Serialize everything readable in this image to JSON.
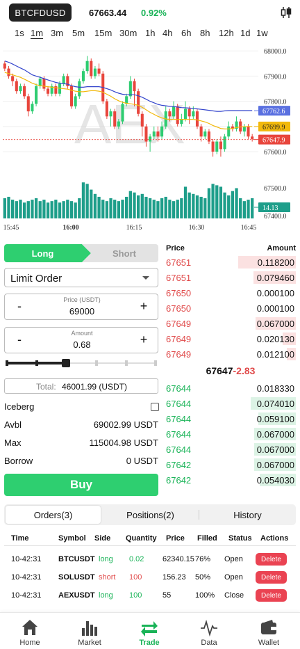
{
  "header": {
    "symbol": "BTCFDUSD",
    "last_price": "67663.44",
    "change_pct": "0.92%"
  },
  "intervals": {
    "items": [
      "1s",
      "1m",
      "3m",
      "5m",
      "15m",
      "30m",
      "1h",
      "4h",
      "6h",
      "8h",
      "12h",
      "1d",
      "1w"
    ],
    "active": "1m"
  },
  "chart": {
    "watermark": "AEX",
    "y_ticks": [
      "68000.0",
      "67900.0",
      "67800.0",
      "67600.0",
      "67500.0",
      "67400.0"
    ],
    "x_ticks": [
      "15:45",
      "16:00",
      "16:15",
      "16:30",
      "16:45"
    ],
    "price_tags": {
      "ma_blue": "67762.6",
      "ma_yellow": "67699.9",
      "last": "67647.9",
      "volume": "14.13"
    },
    "colors": {
      "up": "#2ecc71",
      "down": "#e8453c",
      "ma_blue": "#3344cc",
      "ma_yellow": "#f2b90c",
      "volume": "#1e9e8a"
    }
  },
  "chart_data": {
    "type": "candlestick",
    "interval": "1m",
    "x": [
      "15:45",
      "16:00",
      "16:15",
      "16:30",
      "16:45"
    ],
    "ylim": [
      67400,
      68020
    ],
    "candles": [
      [
        67950,
        67930,
        67960,
        67920
      ],
      [
        67930,
        67900,
        67940,
        67890
      ],
      [
        67900,
        67880,
        67910,
        67860
      ],
      [
        67880,
        67840,
        67890,
        67830
      ],
      [
        67840,
        67860,
        67870,
        67830
      ],
      [
        67860,
        67820,
        67870,
        67810
      ],
      [
        67820,
        67760,
        67830,
        67740
      ],
      [
        67760,
        67790,
        67800,
        67750
      ],
      [
        67790,
        67860,
        67870,
        67780
      ],
      [
        67860,
        67890,
        67900,
        67850
      ],
      [
        67890,
        67850,
        67900,
        67840
      ],
      [
        67850,
        67830,
        67860,
        67820
      ],
      [
        67830,
        67860,
        67870,
        67820
      ],
      [
        67860,
        67830,
        67870,
        67820
      ],
      [
        67830,
        67870,
        67880,
        67820
      ],
      [
        67870,
        67900,
        67910,
        67860
      ],
      [
        67900,
        67860,
        67910,
        67850
      ],
      [
        67860,
        67780,
        67870,
        67770
      ],
      [
        67780,
        67820,
        67830,
        67770
      ],
      [
        67820,
        67880,
        67890,
        67810
      ],
      [
        67880,
        67920,
        67930,
        67870
      ],
      [
        67920,
        67960,
        67980,
        67910
      ],
      [
        67960,
        67900,
        67970,
        67890
      ],
      [
        67900,
        67930,
        67940,
        67890
      ],
      [
        67930,
        67910,
        67950,
        67900
      ],
      [
        67910,
        67800,
        67920,
        67790
      ],
      [
        67800,
        67740,
        67810,
        67730
      ],
      [
        67740,
        67760,
        67770,
        67700
      ],
      [
        67760,
        67700,
        67770,
        67690
      ],
      [
        67700,
        67720,
        67730,
        67690
      ],
      [
        67720,
        67790,
        67800,
        67710
      ],
      [
        67790,
        67820,
        67830,
        67780
      ],
      [
        67820,
        67880,
        67900,
        67810
      ],
      [
        67880,
        67840,
        67890,
        67780
      ],
      [
        67840,
        67750,
        67850,
        67740
      ],
      [
        67750,
        67700,
        67760,
        67660
      ],
      [
        67700,
        67640,
        67710,
        67620
      ],
      [
        67640,
        67660,
        67670,
        67600
      ],
      [
        67660,
        67680,
        67700,
        67650
      ],
      [
        67680,
        67660,
        67700,
        67640
      ],
      [
        67660,
        67700,
        67720,
        67650
      ],
      [
        67700,
        67760,
        67780,
        67690
      ],
      [
        67760,
        67740,
        67770,
        67720
      ],
      [
        67740,
        67780,
        67800,
        67730
      ],
      [
        67780,
        67710,
        67790,
        67700
      ],
      [
        67710,
        67730,
        67750,
        67700
      ],
      [
        67730,
        67770,
        67800,
        67720
      ],
      [
        67770,
        67740,
        67780,
        67710
      ],
      [
        67740,
        67760,
        67780,
        67730
      ],
      [
        67760,
        67700,
        67770,
        67690
      ],
      [
        67700,
        67660,
        67710,
        67640
      ],
      [
        67660,
        67680,
        67690,
        67650
      ],
      [
        67680,
        67640,
        67690,
        67630
      ],
      [
        67640,
        67600,
        67650,
        67580
      ],
      [
        67600,
        67640,
        67650,
        67590
      ],
      [
        67640,
        67610,
        67660,
        67580
      ],
      [
        67610,
        67660,
        67670,
        67600
      ],
      [
        67660,
        67700,
        67720,
        67650
      ],
      [
        67700,
        67690,
        67710,
        67680
      ],
      [
        67690,
        67720,
        67740,
        67680
      ],
      [
        67720,
        67680,
        67730,
        67670
      ],
      [
        67680,
        67700,
        67710,
        67660
      ],
      [
        67700,
        67660,
        67710,
        67650
      ],
      [
        67660,
        67650,
        67670,
        67640
      ]
    ],
    "ma_blue": [
      67960,
      67955,
      67948,
      67940,
      67932,
      67925,
      67915,
      67905,
      67900,
      67895,
      67890,
      67885,
      67880,
      67875,
      67872,
      67870,
      67868,
      67862,
      67858,
      67856,
      67856,
      67858,
      67858,
      67858,
      67858,
      67855,
      67850,
      67845,
      67838,
      67832,
      67828,
      67826,
      67826,
      67826,
      67822,
      67816,
      67808,
      67800,
      67794,
      67788,
      67784,
      67782,
      67780,
      67779,
      67777,
      67775,
      67774,
      67773,
      67772,
      67770,
      67768,
      67766,
      67764,
      67762,
      67760,
      67760,
      67762,
      67763,
      67763,
      67763,
      67763,
      67763,
      67763,
      67763
    ],
    "ma_yellow": [
      67915,
      67910,
      67905,
      67900,
      67895,
      67888,
      67880,
      67872,
      67866,
      67862,
      67860,
      67858,
      67856,
      67854,
      67852,
      67850,
      67848,
      67844,
      67840,
      67838,
      67838,
      67840,
      67842,
      67842,
      67840,
      67836,
      67828,
      67820,
      67810,
      67802,
      67796,
      67792,
      67790,
      67788,
      67784,
      67776,
      67766,
      67756,
      67748,
      67740,
      67734,
      67730,
      67728,
      67728,
      67728,
      67728,
      67728,
      67728,
      67728,
      67726,
      67722,
      67718,
      67712,
      67704,
      67698,
      67692,
      67690,
      67690,
      67692,
      67696,
      67698,
      67699,
      67700,
      67700
    ],
    "volume": [
      14,
      15,
      13,
      12,
      13,
      11,
      12,
      13,
      14,
      12,
      13,
      11,
      12,
      13,
      11,
      12,
      13,
      12,
      11,
      14,
      25,
      24,
      20,
      17,
      15,
      13,
      12,
      14,
      13,
      12,
      13,
      15,
      19,
      18,
      16,
      17,
      15,
      14,
      13,
      12,
      14,
      15,
      13,
      12,
      13,
      14,
      22,
      18,
      17,
      16,
      15,
      14,
      21,
      24,
      23,
      22,
      18,
      16,
      19,
      21,
      14,
      12,
      13,
      14
    ]
  },
  "order_form": {
    "long_label": "Long",
    "short_label": "Short",
    "order_type": "Limit Order",
    "price_caption": "Price (USDT)",
    "price_value": "69000",
    "amount_caption": "Amount",
    "amount_value": "0.68",
    "slider_percent": 40,
    "total_label": "Total:",
    "total_value": "46001.99 (USDT)",
    "iceberg_label": "Iceberg",
    "avbl_label": "Avbl",
    "avbl_value": "69002.99 USDT",
    "max_label": "Max",
    "max_value": "115004.98 USDT",
    "borrow_label": "Borrow",
    "borrow_value": "0 USDT",
    "buy_label": "Buy",
    "minus": "-",
    "plus": "+"
  },
  "orderbook": {
    "price_header": "Price",
    "amount_header": "Amount",
    "asks": [
      {
        "price": "67651",
        "amount": "0.118200",
        "depth": 0.43
      },
      {
        "price": "67651",
        "amount": "0.079460",
        "depth": 0.32
      },
      {
        "price": "67650",
        "amount": "0.000100",
        "depth": 0.0
      },
      {
        "price": "67650",
        "amount": "0.000100",
        "depth": 0.0
      },
      {
        "price": "67649",
        "amount": "0.067000",
        "depth": 0.3
      },
      {
        "price": "67649",
        "amount": "0.020130",
        "depth": 0.1
      },
      {
        "price": "67649",
        "amount": "0.012100",
        "depth": 0.07
      }
    ],
    "mid_price": "67647",
    "mid_change": "-2.83",
    "bids": [
      {
        "price": "67644",
        "amount": "0.018330",
        "depth": 0.0
      },
      {
        "price": "67644",
        "amount": "0.074010",
        "depth": 0.34
      },
      {
        "price": "67644",
        "amount": "0.059100",
        "depth": 0.28
      },
      {
        "price": "67644",
        "amount": "0.067000",
        "depth": 0.31
      },
      {
        "price": "67644",
        "amount": "0.067000",
        "depth": 0.31
      },
      {
        "price": "67642",
        "amount": "0.067000",
        "depth": 0.31
      },
      {
        "price": "67642",
        "amount": "0.054030",
        "depth": 0.27
      }
    ]
  },
  "orders_tabs": {
    "orders": "Orders(3)",
    "positions": "Positions(2)",
    "history": "History"
  },
  "orders_table": {
    "headers": [
      "Time",
      "Symbol",
      "Side",
      "Quantity",
      "Price",
      "Filled",
      "Status",
      "Actions"
    ],
    "rows": [
      {
        "time": "10-42:31",
        "symbol": "BTCUSDT",
        "side": "long",
        "quantity": "0.02",
        "price": "62340.15",
        "filled": "76%",
        "status": "Open",
        "action": "Delete"
      },
      {
        "time": "10-42:31",
        "symbol": "SOLUSDT",
        "side": "short",
        "quantity": "100",
        "price": "156.23",
        "filled": "50%",
        "status": "Open",
        "action": "Delete"
      },
      {
        "time": "10-42:31",
        "symbol": "AEXUSDT",
        "side": "long",
        "quantity": "100",
        "price": "55",
        "filled": "100%",
        "status": "Close",
        "action": "Delete"
      }
    ]
  },
  "bottom_nav": {
    "items": [
      {
        "label": "Home",
        "icon": "home-icon"
      },
      {
        "label": "Market",
        "icon": "bar-chart-icon"
      },
      {
        "label": "Trade",
        "icon": "swap-arrows-icon"
      },
      {
        "label": "Data",
        "icon": "pulse-icon"
      },
      {
        "label": "Wallet",
        "icon": "wallet-icon"
      }
    ],
    "active": "Trade"
  }
}
